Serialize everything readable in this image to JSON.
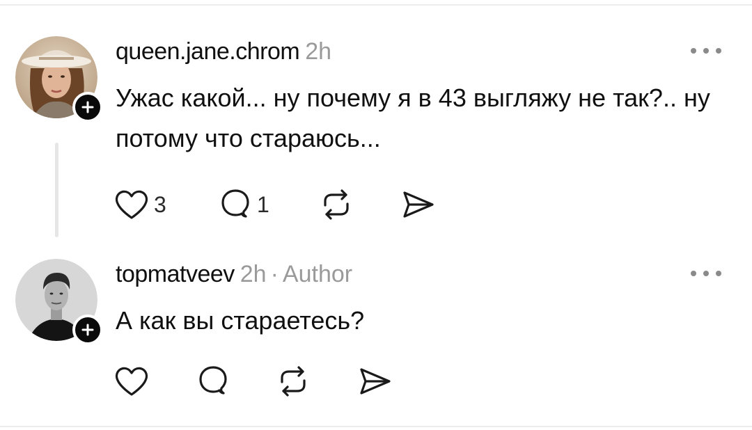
{
  "posts": [
    {
      "username": "queen.jane.chrom",
      "time": "2h",
      "text": "Ужас какой... ну почему я в 43 выгляжу не так?.. ну потому что стараюсь...",
      "like_count": "3",
      "reply_count": "1"
    },
    {
      "username": "topmatveev",
      "time": "2h",
      "separator": "·",
      "author_tag": "Author",
      "text": "А как вы стараетесь?"
    }
  ],
  "icons": {
    "like": "heart-icon",
    "reply": "comment-bubble-icon",
    "repost": "repost-icon",
    "share": "send-icon",
    "more": "more-dots-icon",
    "follow": "plus-icon"
  },
  "colors": {
    "text": "#101010",
    "muted": "#9a9a9a",
    "badge": "#0a0a0a"
  }
}
